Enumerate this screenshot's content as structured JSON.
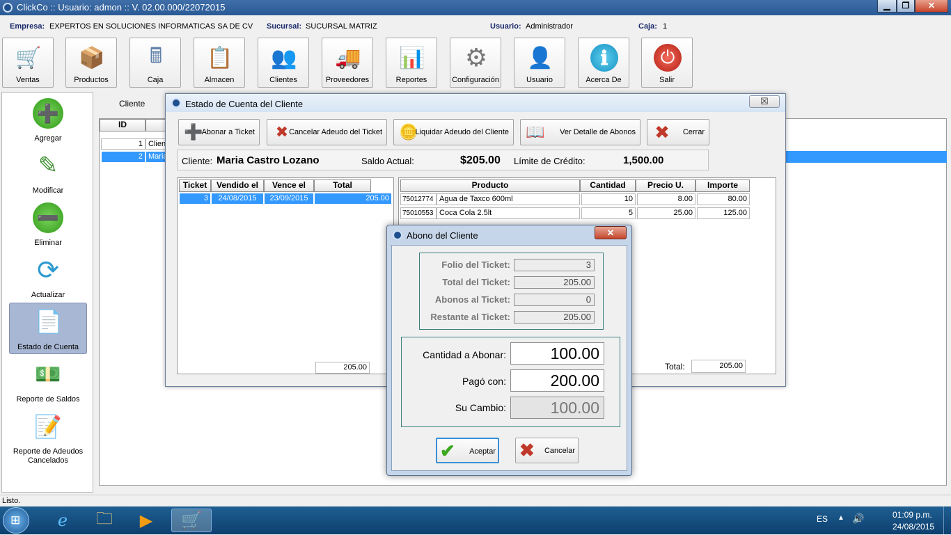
{
  "window": {
    "title": "ClickCo :: Usuario: admon :: V. 02.00.000/22072015",
    "min": "▁",
    "max": "❐",
    "close": "✕"
  },
  "info": {
    "empresa_label": "Empresa:",
    "empresa": "EXPERTOS EN SOLUCIONES INFORMATICAS SA DE CV",
    "sucursal_label": "Sucursal:",
    "sucursal": "SUCURSAL MATRIZ",
    "usuario_label": "Usuario:",
    "usuario": "Administrador",
    "caja_label": "Caja:",
    "caja": "1"
  },
  "toolbar": [
    {
      "label": "Ventas",
      "icon": "🛒"
    },
    {
      "label": "Productos",
      "icon": "📦"
    },
    {
      "label": "Caja",
      "icon": "🖩"
    },
    {
      "label": "Almacen",
      "icon": "📋"
    },
    {
      "label": "Clientes",
      "icon": "👥"
    },
    {
      "label": "Proveedores",
      "icon": "🚚"
    },
    {
      "label": "Reportes",
      "icon": "📊"
    },
    {
      "label": "Configuración",
      "icon": "⚙"
    },
    {
      "label": "Usuario",
      "icon": "👤"
    },
    {
      "label": "Acerca De",
      "icon": "ℹ"
    },
    {
      "label": "Salir",
      "icon": "⏻"
    }
  ],
  "sidebar": [
    {
      "label": "Agregar",
      "icon": "➕"
    },
    {
      "label": "Modificar",
      "icon": "✎"
    },
    {
      "label": "Eliminar",
      "icon": "➖"
    },
    {
      "label": "Actualizar",
      "icon": "⟳"
    },
    {
      "label": "Estado de Cuenta",
      "icon": "📄"
    },
    {
      "label": "Reporte de Saldos",
      "icon": "💵"
    },
    {
      "label": "Reporte de Adeudos Cancelados",
      "icon": "📝"
    }
  ],
  "clients": {
    "label": "Cliente",
    "col_id": "ID",
    "rows": [
      {
        "id": "1",
        "name": "Client"
      },
      {
        "id": "2",
        "name": "Maria"
      }
    ]
  },
  "estado": {
    "title": "Estado de Cuenta del Cliente",
    "close": "☒",
    "buttons": [
      {
        "label": "Abonar a Ticket",
        "icon": "➕"
      },
      {
        "label": "Cancelar Adeudo del Ticket",
        "icon": "✖"
      },
      {
        "label": "Liquidar Adeudo del Cliente",
        "icon": "🪙"
      },
      {
        "label": "Ver Detalle de Abonos",
        "icon": "📖"
      },
      {
        "label": "Cerrar",
        "icon": "✖"
      }
    ],
    "cliente_label": "Cliente:",
    "cliente": "Maria Castro Lozano",
    "saldo_label": "Saldo Actual:",
    "saldo": "$205.00",
    "limite_label": "Límite de Crédito:",
    "limite": "1,500.00",
    "tickets_headers": [
      "Ticket",
      "Vendido el",
      "Vence el",
      "Total"
    ],
    "tickets": [
      {
        "ticket": "3",
        "vendido": "24/08/2015",
        "vence": "23/09/2015",
        "total": "205.00"
      }
    ],
    "tickets_total": "205.00",
    "products_headers": [
      "Producto",
      "Cantidad",
      "Precio U.",
      "Importe"
    ],
    "products": [
      {
        "code": "75012774",
        "name": "Agua de Taxco 600ml",
        "cantidad": "10",
        "precio": "8.00",
        "importe": "80.00"
      },
      {
        "code": "75010553",
        "name": "Coca Cola 2.5lt",
        "cantidad": "5",
        "precio": "25.00",
        "importe": "125.00"
      }
    ],
    "total_label": "Total:",
    "total": "205.00"
  },
  "abono": {
    "title": "Abono del Cliente",
    "close": "✕",
    "folio_label": "Folio del Ticket:",
    "folio": "3",
    "total_label": "Total del Ticket:",
    "total": "205.00",
    "abonos_label": "Abonos al Ticket:",
    "abonos": "0",
    "restante_label": "Restante al Ticket:",
    "restante": "205.00",
    "cantidad_label": "Cantidad a Abonar:",
    "cantidad": "100.00",
    "pago_label": "Pagó con:",
    "pago": "200.00",
    "cambio_label": "Su Cambio:",
    "cambio": "100.00",
    "accept": "Aceptar",
    "cancel": "Cancelar"
  },
  "status": "Listo.",
  "taskbar": {
    "lang": "ES",
    "time": "01:09 p.m.",
    "date": "24/08/2015"
  }
}
